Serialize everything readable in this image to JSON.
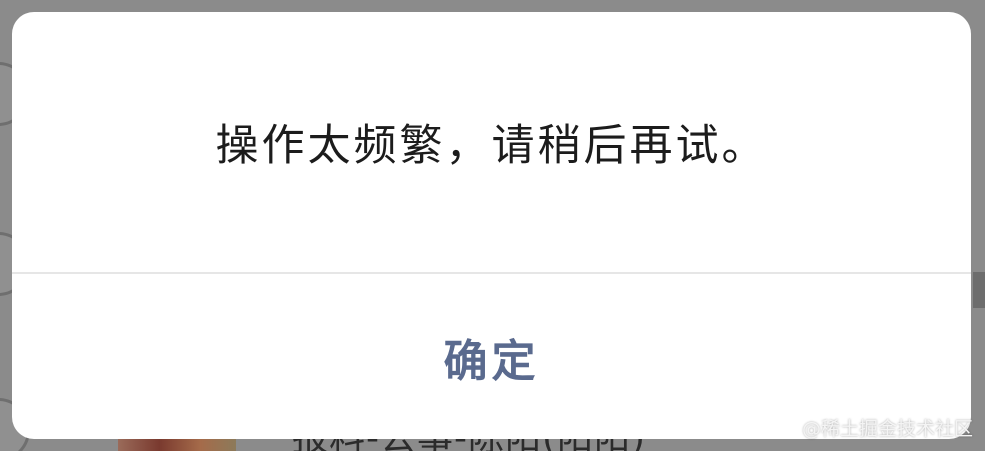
{
  "dialog": {
    "message": "操作太频繁，请稍后再试。",
    "confirm_label": "确定"
  },
  "background": {
    "partial_text": "报料-公事-陈阳(阳阳)"
  },
  "watermark": {
    "text": "@稀土掘金技术社区"
  },
  "colors": {
    "overlay": "#8b8b8b",
    "dialog_bg": "#ffffff",
    "message_text": "#1c1c1c",
    "button_text": "#5a6a8e",
    "divider": "#e6e6e6"
  }
}
